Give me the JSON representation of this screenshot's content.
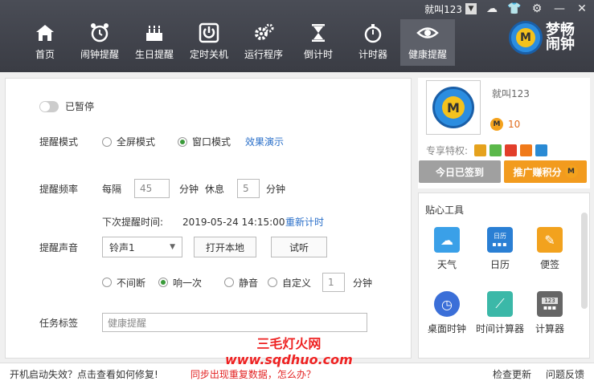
{
  "window": {
    "username": "就叫123"
  },
  "nav": [
    {
      "label": "首页",
      "icon": "home-icon"
    },
    {
      "label": "闹钟提醒",
      "icon": "alarm-icon"
    },
    {
      "label": "生日提醒",
      "icon": "cake-icon"
    },
    {
      "label": "定时关机",
      "icon": "power-icon"
    },
    {
      "label": "运行程序",
      "icon": "gears-icon"
    },
    {
      "label": "倒计时",
      "icon": "hourglass-icon"
    },
    {
      "label": "计时器",
      "icon": "stopwatch-icon"
    },
    {
      "label": "健康提醒",
      "icon": "eye-icon",
      "active": true
    }
  ],
  "brand": {
    "name": "梦畅闹钟",
    "logo_letter": "M"
  },
  "form": {
    "pause_label": "已暂停",
    "mode_label": "提醒模式",
    "mode_fullscreen": "全屏模式",
    "mode_window": "窗口模式",
    "demo_link": "效果演示",
    "freq_label": "提醒频率",
    "every": "每隔",
    "every_value": "45",
    "minute": "分钟",
    "rest": "休息",
    "rest_value": "5",
    "next_label": "下次提醒时间:",
    "next_time": "2019-05-24 14:15:00",
    "recount_link": "重新计时",
    "sound_label": "提醒声音",
    "sound_select": "铃声1",
    "open_local": "打开本地",
    "listen": "试听",
    "opt_continuous": "不间断",
    "opt_once": "响一次",
    "opt_mute": "静音",
    "opt_custom": "自定义",
    "custom_value": "1",
    "task_label": "任务标签",
    "task_placeholder": "健康提醒"
  },
  "profile": {
    "username": "就叫123",
    "coins": "10",
    "privilege_label": "专享特权:",
    "signed_button": "今日已签到",
    "promo_button": "推广赚积分"
  },
  "tools": {
    "title": "贴心工具",
    "calendar_header": "日历",
    "calculator_display": "123",
    "items": [
      {
        "label": "天气",
        "color": "#3aa0e8"
      },
      {
        "label": "日历",
        "color": "#2a7fd4"
      },
      {
        "label": "便签",
        "color": "#f2a21e"
      },
      {
        "label": "桌面时钟",
        "color": "#3b6fd8"
      },
      {
        "label": "时间计算器",
        "color": "#3bb8a8"
      },
      {
        "label": "计算器",
        "color": "#666666"
      }
    ]
  },
  "footer": {
    "startup_fail": "开机启动失效？点击查看如何修复!",
    "sync_issue": "同步出现重复数据，怎么办？",
    "check_update": "检查更新",
    "feedback": "问题反馈"
  },
  "watermark": {
    "line1": "三毛灯火网",
    "line2": "www.sqdhuo.com"
  },
  "colors": {
    "accent": "#2a6fc9",
    "promo": "#f29b1e",
    "link_red": "#e22222"
  }
}
